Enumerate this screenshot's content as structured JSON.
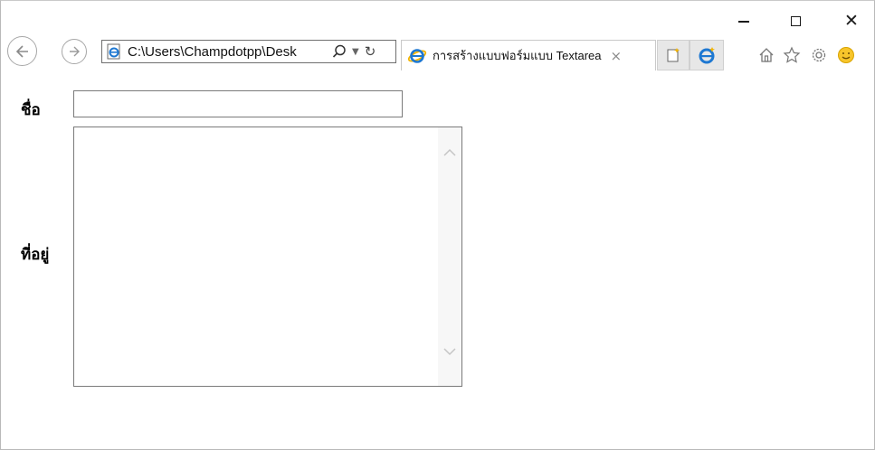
{
  "browser": {
    "address": "C:\\Users\\Champdotpp\\Desk",
    "tab_title": "การสร้างแบบฟอร์มแบบ Textarea",
    "tab_close": "×"
  },
  "form": {
    "name_label": "ชื่อ",
    "address_label": "ที่อยู่",
    "name_value": "",
    "address_value": ""
  },
  "colors": {
    "ie_blue": "#1e78d2",
    "ie_gold": "#f4b400"
  }
}
